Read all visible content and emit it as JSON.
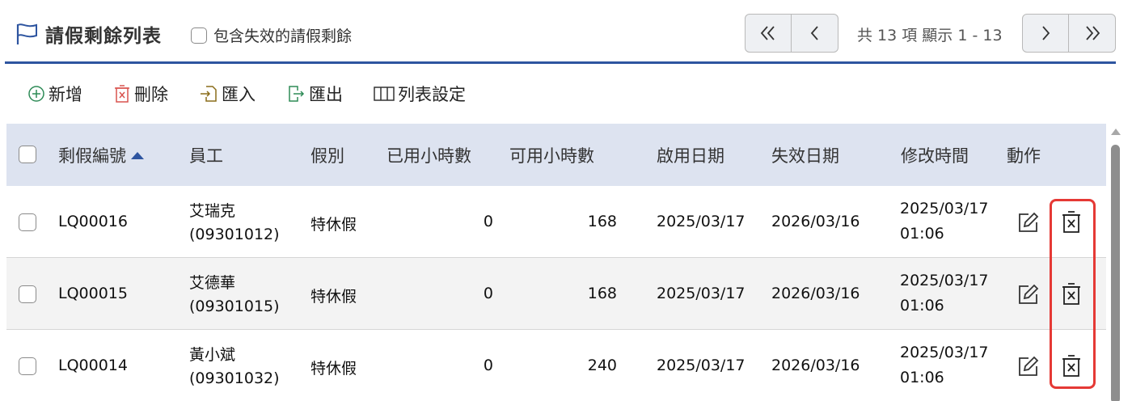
{
  "header": {
    "title": "請假剩餘列表",
    "include_expired_label": "包含失效的請假剩餘",
    "pager_info": "共 13 項 顯示 1 - 13"
  },
  "toolbar": {
    "add_label": "新增",
    "delete_label": "刪除",
    "import_label": "匯入",
    "export_label": "匯出",
    "columns_label": "列表設定"
  },
  "table": {
    "columns": [
      "剩假編號",
      "員工",
      "假別",
      "已用小時數",
      "可用小時數",
      "啟用日期",
      "失效日期",
      "修改時間",
      "動作"
    ],
    "rows": [
      {
        "id": "LQ00016",
        "name": "艾瑞克",
        "emp_no": "(09301012)",
        "type": "特休假",
        "used": "0",
        "avail": "168",
        "start": "2025/03/17",
        "end": "2026/03/16",
        "mod_date": "2025/03/17",
        "mod_time": "01:06"
      },
      {
        "id": "LQ00015",
        "name": "艾德華",
        "emp_no": "(09301015)",
        "type": "特休假",
        "used": "0",
        "avail": "168",
        "start": "2025/03/17",
        "end": "2026/03/16",
        "mod_date": "2025/03/17",
        "mod_time": "01:06"
      },
      {
        "id": "LQ00014",
        "name": "黃小斌",
        "emp_no": "(09301032)",
        "type": "特休假",
        "used": "0",
        "avail": "240",
        "start": "2025/03/17",
        "end": "2026/03/16",
        "mod_date": "2025/03/17",
        "mod_time": "01:06"
      }
    ]
  },
  "colors": {
    "accent": "#2e55a0",
    "header_bg": "#dde3f0",
    "highlight": "#e53935",
    "add_green": "#2e8b57",
    "delete_red": "#d9534f"
  }
}
